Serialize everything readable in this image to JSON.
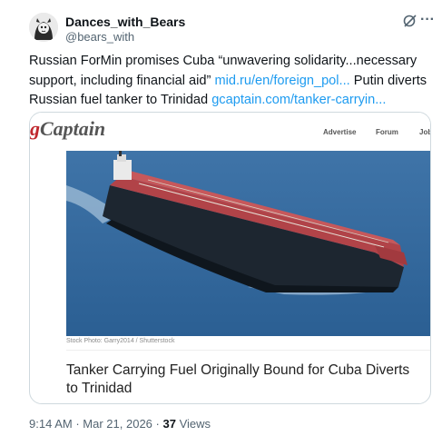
{
  "tweet": {
    "display_name": "Dances_with_Bears",
    "handle": "@bears_with",
    "text_part1": "Russian ForMin  promises Cuba “unwavering solidarity...necessary support, including financial aid” ",
    "link1": "mid.ru/en/foreign_pol...",
    "text_part2": " Putin diverts Russian fuel tanker to Trinidad ",
    "link2": "gcaptain.com/tanker-carryin...",
    "time": "9:14 AM",
    "date": "Mar 21, 2026",
    "separator": "·",
    "views_count": "37",
    "views_label": "Views"
  },
  "card": {
    "logo_g": "g",
    "logo_rest": "Captain",
    "nav": [
      "Advertise",
      "Forum",
      "Jobs"
    ],
    "photo_credit": "Stock Photo: Garry2014 / Shutterstock",
    "headline": "Tanker Carrying Fuel Originally Bound for Cuba Diverts to Trinidad"
  },
  "icons": {
    "grok": "grok-icon",
    "more": "more-icon",
    "avatar": "avatar"
  }
}
